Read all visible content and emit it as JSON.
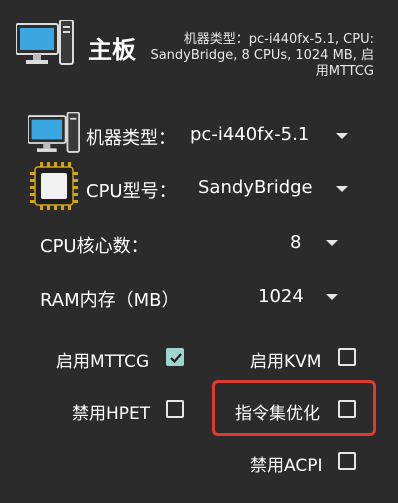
{
  "header": {
    "title": "主板",
    "summary": "机器类型：pc-i440fx-5.1, CPU: SandyBridge, 8 CPUs, 1024 MB, 启用MTTCG",
    "icon": "computer-monitor-icon"
  },
  "machine": {
    "label": "机器类型：",
    "value": "pc-i440fx-5.1",
    "icon": "computer-monitor-icon"
  },
  "cpu_model": {
    "label": "CPU型号：",
    "value": "SandyBridge",
    "icon": "cpu-chip-icon"
  },
  "cpu_cores": {
    "label": "CPU核心数：",
    "value": "8"
  },
  "ram": {
    "label": "RAM内存（MB）",
    "value": "1024"
  },
  "options": {
    "mttcg": {
      "label": "启用MTTCG",
      "checked": true
    },
    "kvm": {
      "label": "启用KVM",
      "checked": false
    },
    "hpet": {
      "label": "禁用HPET",
      "checked": false
    },
    "instr_opt": {
      "label": "指令集优化",
      "checked": false
    },
    "acpi": {
      "label": "禁用ACPI",
      "checked": false
    }
  },
  "colors": {
    "background": "#2b2b2b",
    "checkbox_checked": "#9fd5cf",
    "highlight": "#e03a2a"
  }
}
